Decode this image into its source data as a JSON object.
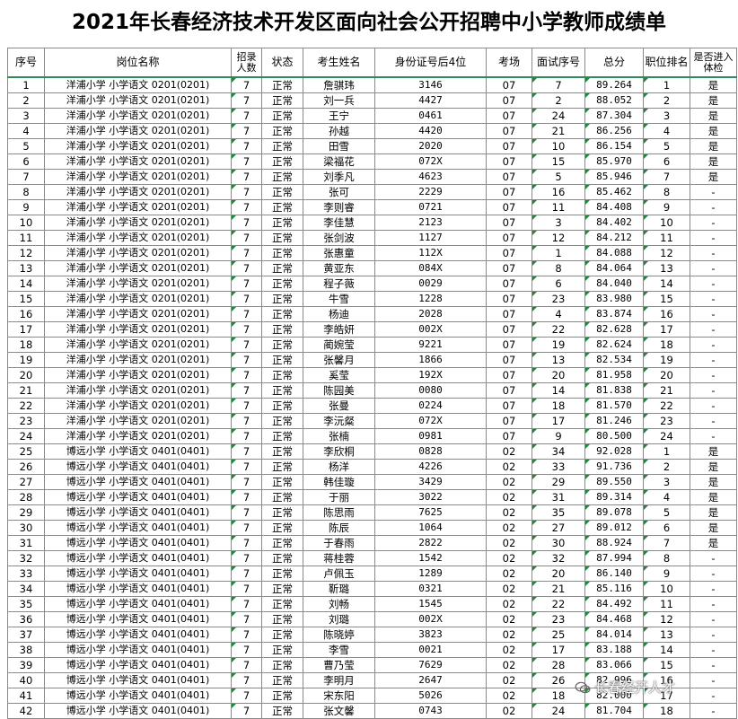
{
  "title": "2021年长春经济技术开发区面向社会公开招聘中小学教师成绩单",
  "headers": [
    "序号",
    "岗位名称",
    "招录人数",
    "状态",
    "考生姓名",
    "身份证号后4位",
    "考场",
    "面试序号",
    "总分",
    "职位排名",
    "是否进入体检"
  ],
  "rows": [
    [
      "1",
      "洋浦小学 小学语文 0201(0201)",
      "7",
      "正常",
      "詹骐玮",
      "3146",
      "07",
      "7",
      "89.264",
      "1",
      "是"
    ],
    [
      "2",
      "洋浦小学 小学语文 0201(0201)",
      "7",
      "正常",
      "刘一兵",
      "4427",
      "07",
      "2",
      "88.052",
      "2",
      "是"
    ],
    [
      "3",
      "洋浦小学 小学语文 0201(0201)",
      "7",
      "正常",
      "王宁",
      "0461",
      "07",
      "24",
      "87.304",
      "3",
      "是"
    ],
    [
      "4",
      "洋浦小学 小学语文 0201(0201)",
      "7",
      "正常",
      "孙越",
      "4420",
      "07",
      "21",
      "86.256",
      "4",
      "是"
    ],
    [
      "5",
      "洋浦小学 小学语文 0201(0201)",
      "7",
      "正常",
      "田雪",
      "2020",
      "07",
      "10",
      "86.154",
      "5",
      "是"
    ],
    [
      "6",
      "洋浦小学 小学语文 0201(0201)",
      "7",
      "正常",
      "梁福花",
      "072X",
      "07",
      "15",
      "85.970",
      "6",
      "是"
    ],
    [
      "7",
      "洋浦小学 小学语文 0201(0201)",
      "7",
      "正常",
      "刘季凡",
      "4623",
      "07",
      "5",
      "85.946",
      "7",
      "是"
    ],
    [
      "8",
      "洋浦小学 小学语文 0201(0201)",
      "7",
      "正常",
      "张可",
      "2229",
      "07",
      "16",
      "85.462",
      "8",
      "-"
    ],
    [
      "9",
      "洋浦小学 小学语文 0201(0201)",
      "7",
      "正常",
      "李则睿",
      "0721",
      "07",
      "11",
      "84.408",
      "9",
      "-"
    ],
    [
      "10",
      "洋浦小学 小学语文 0201(0201)",
      "7",
      "正常",
      "李佳慧",
      "2123",
      "07",
      "3",
      "84.402",
      "10",
      "-"
    ],
    [
      "11",
      "洋浦小学 小学语文 0201(0201)",
      "7",
      "正常",
      "张剑波",
      "1127",
      "07",
      "12",
      "84.212",
      "11",
      "-"
    ],
    [
      "12",
      "洋浦小学 小学语文 0201(0201)",
      "7",
      "正常",
      "张惠童",
      "112X",
      "07",
      "1",
      "84.088",
      "12",
      "-"
    ],
    [
      "13",
      "洋浦小学 小学语文 0201(0201)",
      "7",
      "正常",
      "黄亚东",
      "084X",
      "07",
      "8",
      "84.064",
      "13",
      "-"
    ],
    [
      "14",
      "洋浦小学 小学语文 0201(0201)",
      "7",
      "正常",
      "程子薇",
      "0029",
      "07",
      "6",
      "84.040",
      "14",
      "-"
    ],
    [
      "15",
      "洋浦小学 小学语文 0201(0201)",
      "7",
      "正常",
      "牛雪",
      "1228",
      "07",
      "23",
      "83.980",
      "15",
      "-"
    ],
    [
      "16",
      "洋浦小学 小学语文 0201(0201)",
      "7",
      "正常",
      "杨迪",
      "2028",
      "07",
      "4",
      "83.874",
      "16",
      "-"
    ],
    [
      "17",
      "洋浦小学 小学语文 0201(0201)",
      "7",
      "正常",
      "李皓妍",
      "002X",
      "07",
      "22",
      "82.628",
      "17",
      "-"
    ],
    [
      "18",
      "洋浦小学 小学语文 0201(0201)",
      "7",
      "正常",
      "蔺婉莹",
      "9221",
      "07",
      "19",
      "82.624",
      "18",
      "-"
    ],
    [
      "19",
      "洋浦小学 小学语文 0201(0201)",
      "7",
      "正常",
      "张馨月",
      "1866",
      "07",
      "13",
      "82.534",
      "19",
      "-"
    ],
    [
      "20",
      "洋浦小学 小学语文 0201(0201)",
      "7",
      "正常",
      "奚莹",
      "192X",
      "07",
      "20",
      "81.958",
      "20",
      "-"
    ],
    [
      "21",
      "洋浦小学 小学语文 0201(0201)",
      "7",
      "正常",
      "陈园美",
      "0080",
      "07",
      "14",
      "81.838",
      "21",
      "-"
    ],
    [
      "22",
      "洋浦小学 小学语文 0201(0201)",
      "7",
      "正常",
      "张曼",
      "0224",
      "07",
      "18",
      "81.570",
      "22",
      "-"
    ],
    [
      "23",
      "洋浦小学 小学语文 0201(0201)",
      "7",
      "正常",
      "李沅粲",
      "072X",
      "07",
      "17",
      "81.246",
      "23",
      "-"
    ],
    [
      "24",
      "洋浦小学 小学语文 0201(0201)",
      "7",
      "正常",
      "张楠",
      "0981",
      "07",
      "9",
      "80.500",
      "24",
      "-"
    ],
    [
      "25",
      "博远小学 小学语文 0401(0401)",
      "7",
      "正常",
      "李欣桐",
      "0828",
      "02",
      "34",
      "92.028",
      "1",
      "是"
    ],
    [
      "26",
      "博远小学 小学语文 0401(0401)",
      "7",
      "正常",
      "杨洋",
      "4226",
      "02",
      "33",
      "91.736",
      "2",
      "是"
    ],
    [
      "27",
      "博远小学 小学语文 0401(0401)",
      "7",
      "正常",
      "韩佳璇",
      "3429",
      "02",
      "29",
      "89.550",
      "3",
      "是"
    ],
    [
      "28",
      "博远小学 小学语文 0401(0401)",
      "7",
      "正常",
      "于丽",
      "3022",
      "02",
      "31",
      "89.314",
      "4",
      "是"
    ],
    [
      "29",
      "博远小学 小学语文 0401(0401)",
      "7",
      "正常",
      "陈思雨",
      "7625",
      "02",
      "35",
      "89.078",
      "5",
      "是"
    ],
    [
      "30",
      "博远小学 小学语文 0401(0401)",
      "7",
      "正常",
      "陈辰",
      "1064",
      "02",
      "27",
      "89.012",
      "6",
      "是"
    ],
    [
      "31",
      "博远小学 小学语文 0401(0401)",
      "7",
      "正常",
      "于春雨",
      "2822",
      "02",
      "30",
      "88.924",
      "7",
      "是"
    ],
    [
      "32",
      "博远小学 小学语文 0401(0401)",
      "7",
      "正常",
      "蒋桂蓉",
      "1542",
      "02",
      "32",
      "87.994",
      "8",
      "-"
    ],
    [
      "33",
      "博远小学 小学语文 0401(0401)",
      "7",
      "正常",
      "卢佩玉",
      "1289",
      "02",
      "20",
      "86.140",
      "9",
      "-"
    ],
    [
      "34",
      "博远小学 小学语文 0401(0401)",
      "7",
      "正常",
      "靳璐",
      "0321",
      "02",
      "21",
      "85.116",
      "10",
      "-"
    ],
    [
      "35",
      "博远小学 小学语文 0401(0401)",
      "7",
      "正常",
      "刘畅",
      "1545",
      "02",
      "22",
      "84.492",
      "11",
      "-"
    ],
    [
      "36",
      "博远小学 小学语文 0401(0401)",
      "7",
      "正常",
      "刘璐",
      "002X",
      "02",
      "23",
      "84.468",
      "12",
      "-"
    ],
    [
      "37",
      "博远小学 小学语文 0401(0401)",
      "7",
      "正常",
      "陈晓婷",
      "3823",
      "02",
      "25",
      "84.014",
      "13",
      "-"
    ],
    [
      "38",
      "博远小学 小学语文 0401(0401)",
      "7",
      "正常",
      "李雪",
      "0021",
      "02",
      "17",
      "83.188",
      "14",
      "-"
    ],
    [
      "39",
      "博远小学 小学语文 0401(0401)",
      "7",
      "正常",
      "曹乃莹",
      "7629",
      "02",
      "28",
      "83.066",
      "15",
      "-"
    ],
    [
      "40",
      "博远小学 小学语文 0401(0401)",
      "7",
      "正常",
      "李明月",
      "2647",
      "02",
      "26",
      "82.996",
      "16",
      "-"
    ],
    [
      "41",
      "博远小学 小学语文 0401(0401)",
      "7",
      "正常",
      "宋东阳",
      "5026",
      "02",
      "18",
      "82.000",
      "17",
      "-"
    ],
    [
      "42",
      "博远小学 小学语文 0401(0401)",
      "7",
      "正常",
      "张文馨",
      "0743",
      "02",
      "24",
      "81.704",
      "18",
      "-"
    ]
  ],
  "watermark": "长春经开人才",
  "colors": {
    "cell_marker": "#1a8a3a",
    "header_rule": "#2e8b57"
  }
}
